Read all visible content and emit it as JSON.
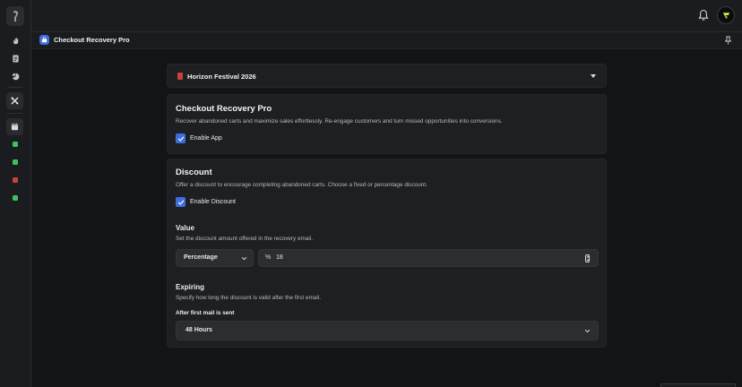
{
  "colors": {
    "background": "#131416",
    "rail": "#1b1c1f",
    "card": "#1e1f22",
    "accent": "#3d6fdc",
    "status_green": "#3fbf5f",
    "status_red": "#c8413a"
  },
  "rail": {
    "icons": [
      "logo-icon",
      "hand-icon",
      "document-icon",
      "pie-chart-icon",
      "tools-icon",
      "calendar-icon"
    ],
    "status_dots": [
      "green",
      "green",
      "red",
      "green"
    ]
  },
  "topbar": {
    "icons": [
      "bell-icon",
      "avatar"
    ]
  },
  "appbar": {
    "title": "Checkout Recovery Pro",
    "icons": [
      "app-bag-icon",
      "pin-icon"
    ]
  },
  "event_select": {
    "label": "Horizon Festival 2026",
    "icons": [
      "calendar-icon",
      "caret-down-icon"
    ]
  },
  "app_card": {
    "title": "Checkout Recovery Pro",
    "description": "Recover abandoned carts and maximize sales effortlessly. Re-engage customers and turn missed opportunities into conversions.",
    "enable_label": "Enable App",
    "enabled": true
  },
  "discount_card": {
    "title": "Discount",
    "description": "Offer a discount to encourage completing abandoned carts. Choose a fixed or percentage discount.",
    "enable_label": "Enable Discount",
    "enabled": true,
    "value": {
      "title": "Value",
      "description": "Set the discount amount offered in the recovery email.",
      "type_selected": "Percentage",
      "unit_symbol": "%",
      "amount": "18"
    },
    "expiring": {
      "title": "Expiring",
      "description": "Specify how long the discount is valid after the first email.",
      "field_label": "After first mail is sent",
      "selected": "48 Hours"
    }
  }
}
